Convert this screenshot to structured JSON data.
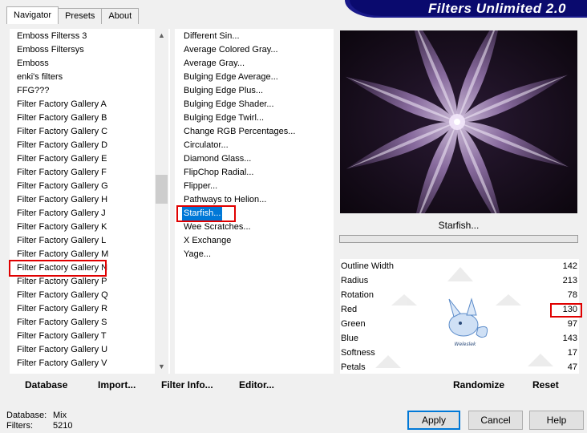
{
  "tabs": [
    {
      "label": "Navigator",
      "active": true
    },
    {
      "label": "Presets",
      "active": false
    },
    {
      "label": "About",
      "active": false
    }
  ],
  "banner": {
    "title": "Filters Unlimited 2.0"
  },
  "categories": [
    "Emboss Filterss 3",
    "Emboss Filtersys",
    "Emboss",
    "enki's filters",
    "FFG???",
    "Filter Factory Gallery A",
    "Filter Factory Gallery B",
    "Filter Factory Gallery C",
    "Filter Factory Gallery D",
    "Filter Factory Gallery E",
    "Filter Factory Gallery F",
    "Filter Factory Gallery G",
    "Filter Factory Gallery H",
    "Filter Factory Gallery J",
    "Filter Factory Gallery K",
    "Filter Factory Gallery L",
    "Filter Factory Gallery M",
    "Filter Factory Gallery N",
    "Filter Factory Gallery P",
    "Filter Factory Gallery Q",
    "Filter Factory Gallery R",
    "Filter Factory Gallery S",
    "Filter Factory Gallery T",
    "Filter Factory Gallery U",
    "Filter Factory Gallery V"
  ],
  "highlighted_category": "Filter Factory Gallery N",
  "filters": [
    "Different Sin...",
    "Average Colored Gray...",
    "Average Gray...",
    "Bulging Edge Average...",
    "Bulging Edge Plus...",
    "Bulging Edge Shader...",
    "Bulging Edge Twirl...",
    "Change RGB Percentages...",
    "Circulator...",
    "Diamond Glass...",
    "FlipChop Radial...",
    "Flipper...",
    "Pathways to Helion...",
    "Starfish...",
    "Wee Scratches...",
    "X Exchange",
    "Yage..."
  ],
  "selected_filter": "Starfish...",
  "preview": {
    "filter_name": "Starfish..."
  },
  "params": [
    {
      "label": "Outline Width",
      "value": "142"
    },
    {
      "label": "Radius",
      "value": "213"
    },
    {
      "label": "Rotation",
      "value": "78"
    },
    {
      "label": "Red",
      "value": "130"
    },
    {
      "label": "Green",
      "value": "97"
    },
    {
      "label": "Blue",
      "value": "143"
    },
    {
      "label": "Softness",
      "value": "17"
    },
    {
      "label": "Petals",
      "value": "47"
    }
  ],
  "highlighted_param": "Red",
  "left_actions": {
    "database": "Database",
    "import": "Import...",
    "filter_info": "Filter Info...",
    "editor": "Editor..."
  },
  "right_actions": {
    "randomize": "Randomize",
    "reset": "Reset"
  },
  "status": {
    "database_label": "Database:",
    "database_value": "Mix",
    "filters_label": "Filters:",
    "filters_value": "5210"
  },
  "buttons": {
    "apply": "Apply",
    "cancel": "Cancel",
    "help": "Help"
  },
  "colors": {
    "highlight_red": "#e00000",
    "selection_blue": "#0078d7",
    "banner_navy": "#0a0a6e",
    "petal_purple": "#9a7ab2"
  }
}
